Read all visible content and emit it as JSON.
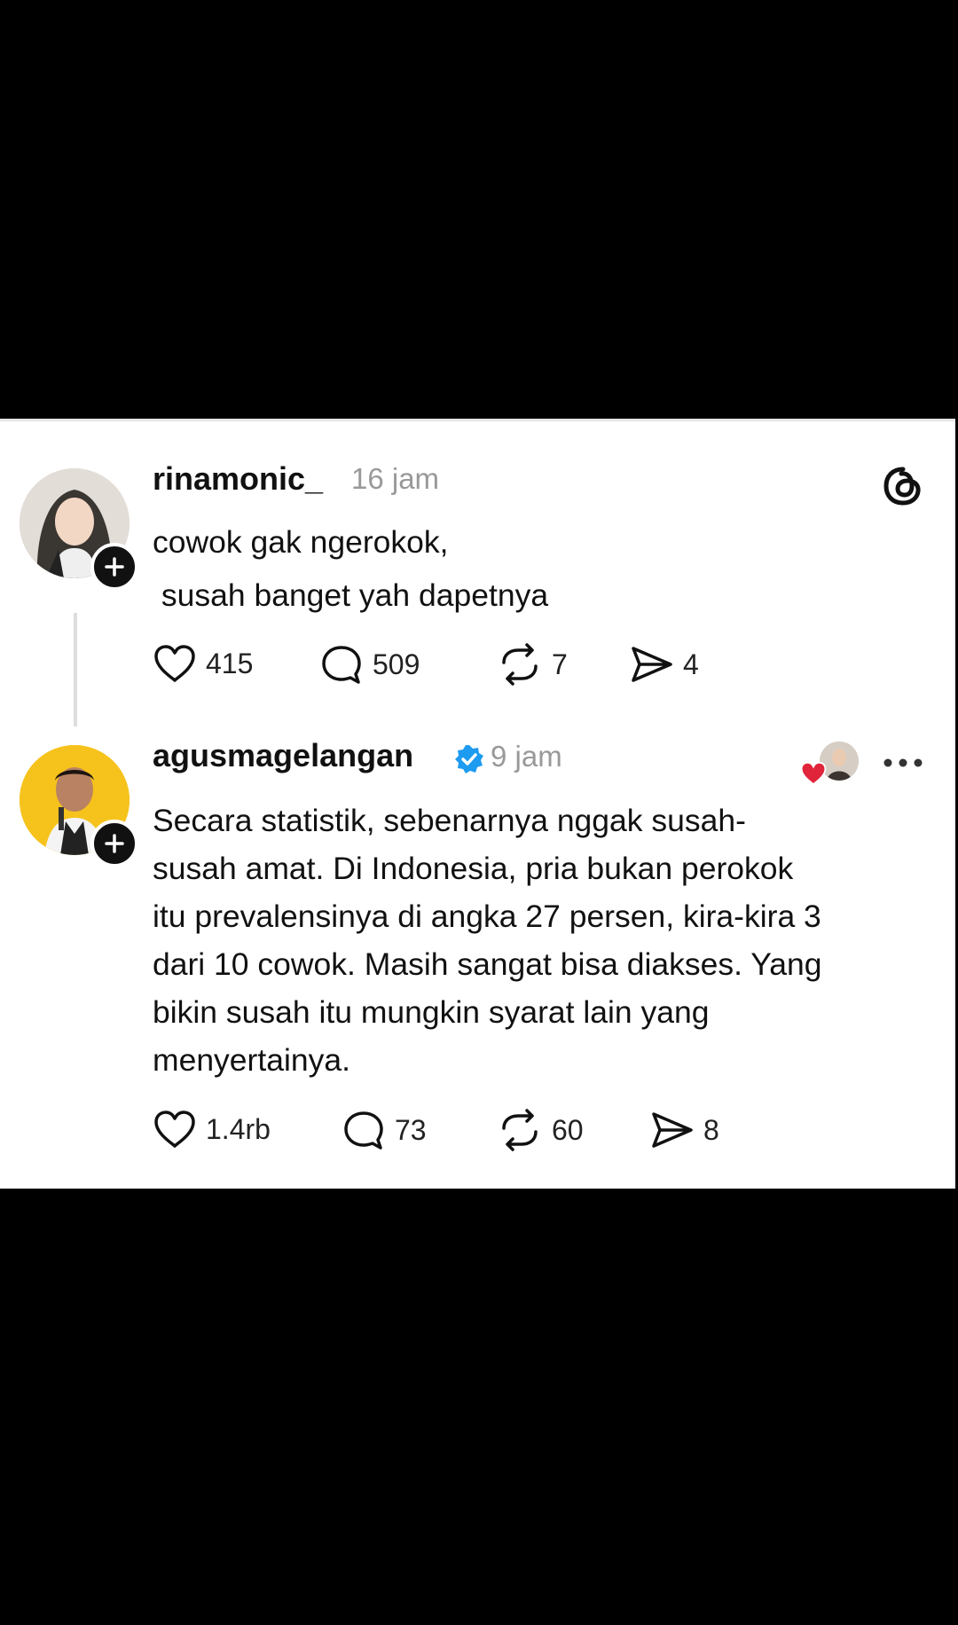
{
  "posts": [
    {
      "username": "rinamonic_",
      "time": "16 jam",
      "lines": [
        "cowok gak ngerokok,",
        " susah banget yah dapetnya"
      ],
      "likes": "415",
      "comments": "509",
      "reposts": "7",
      "shares": "4"
    },
    {
      "username": "agusmagelangan",
      "time": "9 jam",
      "lines": [
        "Secara statistik, sebenarnya nggak susah-",
        "susah amat. Di Indonesia, pria bukan perokok",
        "itu prevalensinya di angka 27 persen, kira-kira 3",
        "dari 10 cowok. Masih sangat bisa diakses. Yang",
        "bikin susah itu mungkin syarat lain yang",
        "menyertainya."
      ],
      "likes": "1.4rb",
      "comments": "73",
      "reposts": "60",
      "shares": "8"
    }
  ],
  "icons": {
    "threads_logo": "threads-logo-icon",
    "verified": "verified-badge-icon",
    "more": "more-options-icon"
  },
  "colors": {
    "verified": "#1d9bf0",
    "heart": "#e0243a"
  }
}
